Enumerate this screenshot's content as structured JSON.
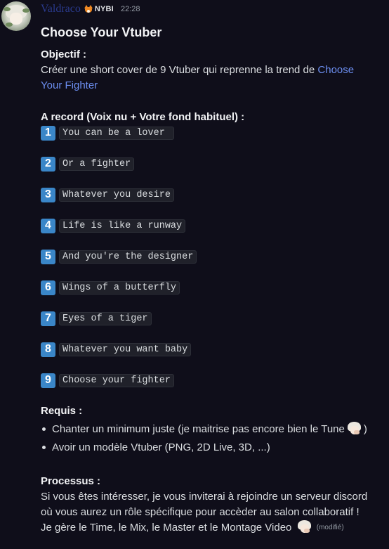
{
  "message": {
    "username": "Valdraco",
    "server_tag": "NYBI",
    "server_tag_icon": "fox-icon",
    "timestamp": "22:28",
    "edited_label": "(modifié)",
    "username_color": "#2a3a8c",
    "link_color": "#6c8ef0",
    "keycap_color": "#3a86c8"
  },
  "post": {
    "title": "Choose Your Vtuber",
    "objective": {
      "label": "Objectif :",
      "text_before": "Créer une short cover de 9 Vtuber qui reprenne la trend de ",
      "link_text": "Choose Your Fighter"
    },
    "record": {
      "label": "A record (Voix nu + Votre fond habituel) :",
      "lines": [
        {
          "number": "1",
          "text": "You can be a lover "
        },
        {
          "number": "2",
          "text": "Or a fighter"
        },
        {
          "number": "3",
          "text": "Whatever you desire"
        },
        {
          "number": "4",
          "text": "Life is like a runway"
        },
        {
          "number": "5",
          "text": "And you're the designer"
        },
        {
          "number": "6",
          "text": "Wings of a butterfly"
        },
        {
          "number": "7",
          "text": "Eyes of a tiger"
        },
        {
          "number": "8",
          "text": "Whatever you want baby"
        },
        {
          "number": "9",
          "text": "Choose your fighter"
        }
      ]
    },
    "requirements": {
      "label": "Requis :",
      "items": [
        {
          "text": "Chanter un minimum juste (je maitrise pas encore bien le Tune",
          "suffix": ")",
          "emoji": "facepalm-emoji"
        },
        {
          "text": "Avoir un modèle Vtuber (PNG, 2D Live, 3D, ...)"
        }
      ]
    },
    "process": {
      "label": "Processus :",
      "line1": "Si vous êtes intéresser, je vous inviterai à rejoindre un serveur discord",
      "line2": "où vous aurez un rôle spécifique pour accèder au salon collaboratif !",
      "line3": "Je gère le Time, le Mix, le Master et le Montage Video",
      "emoji": "facepalm-emoji"
    }
  }
}
